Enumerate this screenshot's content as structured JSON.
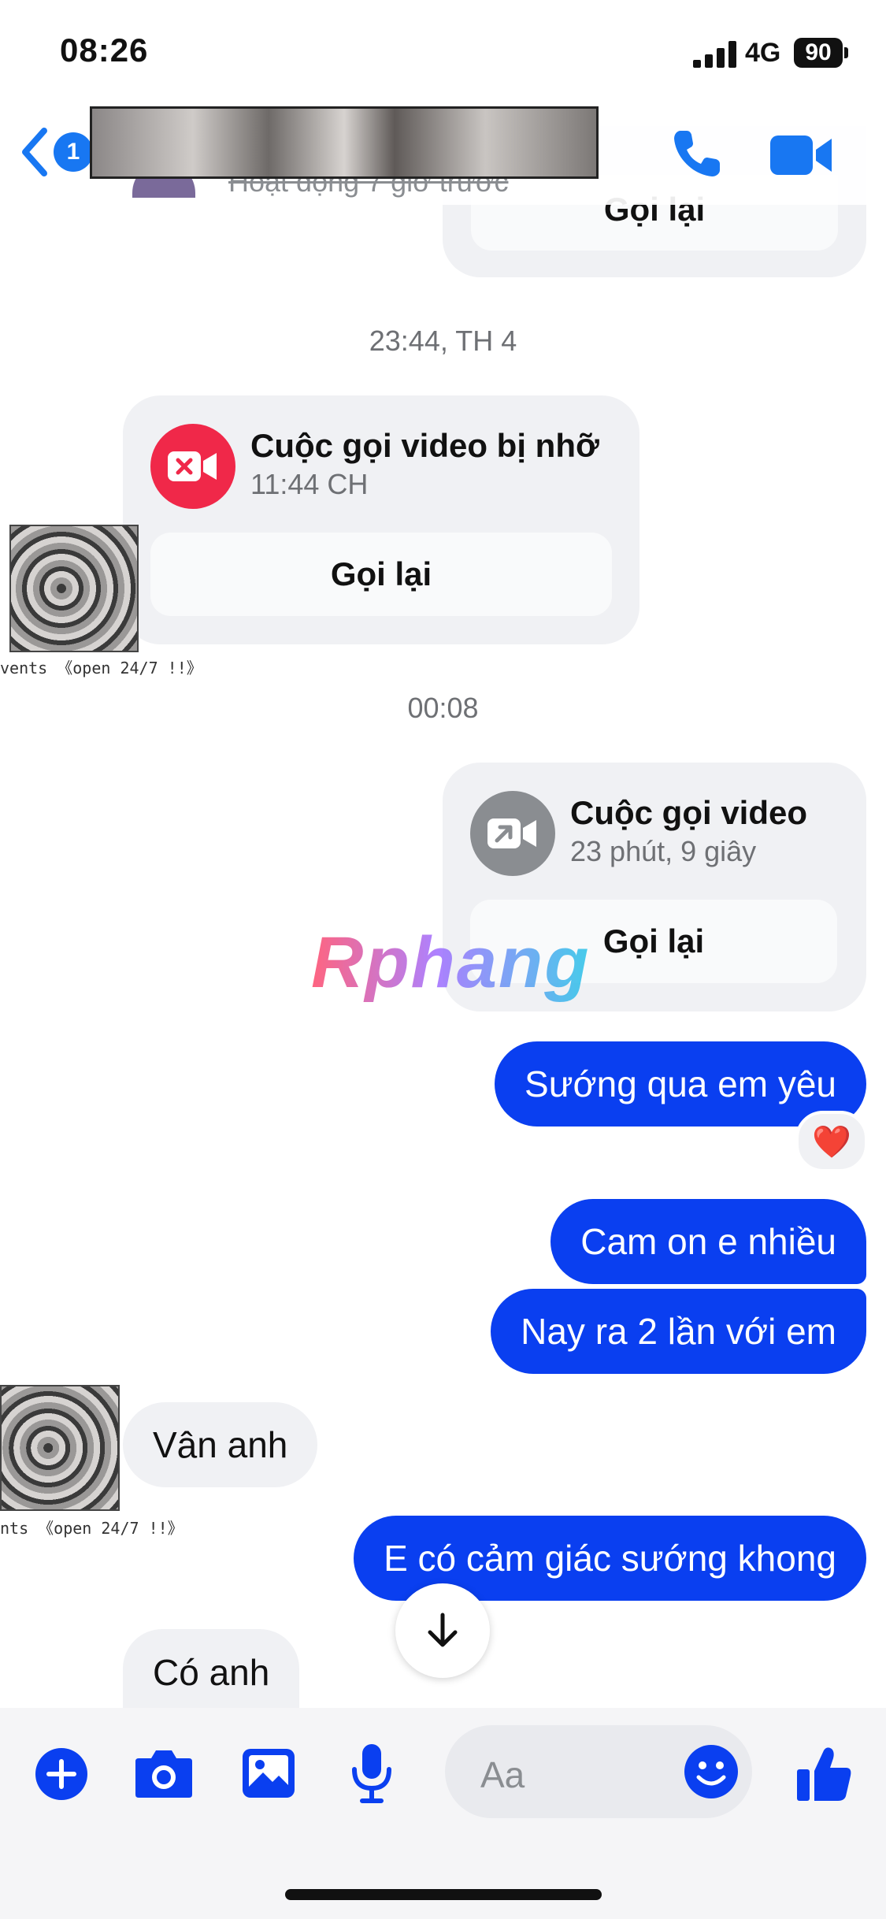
{
  "status_bar": {
    "time": "08:26",
    "network": "4G",
    "battery": "90"
  },
  "header": {
    "back_badge": "1",
    "subtitle": "Hoạt động 7 giờ trước"
  },
  "messages": {
    "top_card_button": "Gọi lại",
    "timestamp1": "23:44, TH 4",
    "missed_call": {
      "title": "Cuộc gọi video bị nhỡ",
      "subtitle": "11:44 CH",
      "button": "Gọi lại"
    },
    "avatar_caption": "vents 《open 24/7 !!》",
    "timestamp2": "00:08",
    "video_call": {
      "title": "Cuộc gọi video",
      "subtitle": "23 phút, 9 giây",
      "button": "Gọi lại"
    },
    "out1": "Sướng qua em yêu",
    "reaction": "❤️",
    "out2": "Cam on e nhiều",
    "out3": "Nay ra 2 lần với em",
    "in1": "Vân anh",
    "avatar_caption2": "nts 《open 24/7 !!》",
    "out4": "E có cảm giác sướng khong",
    "in2": "Có anh"
  },
  "watermark": "Rphang",
  "composer": {
    "placeholder": "Aa"
  },
  "colors": {
    "accent": "#1877f2",
    "outgoing": "#0a3ff0",
    "missed": "#f02849",
    "incoming_bg": "#f0f1f4"
  }
}
